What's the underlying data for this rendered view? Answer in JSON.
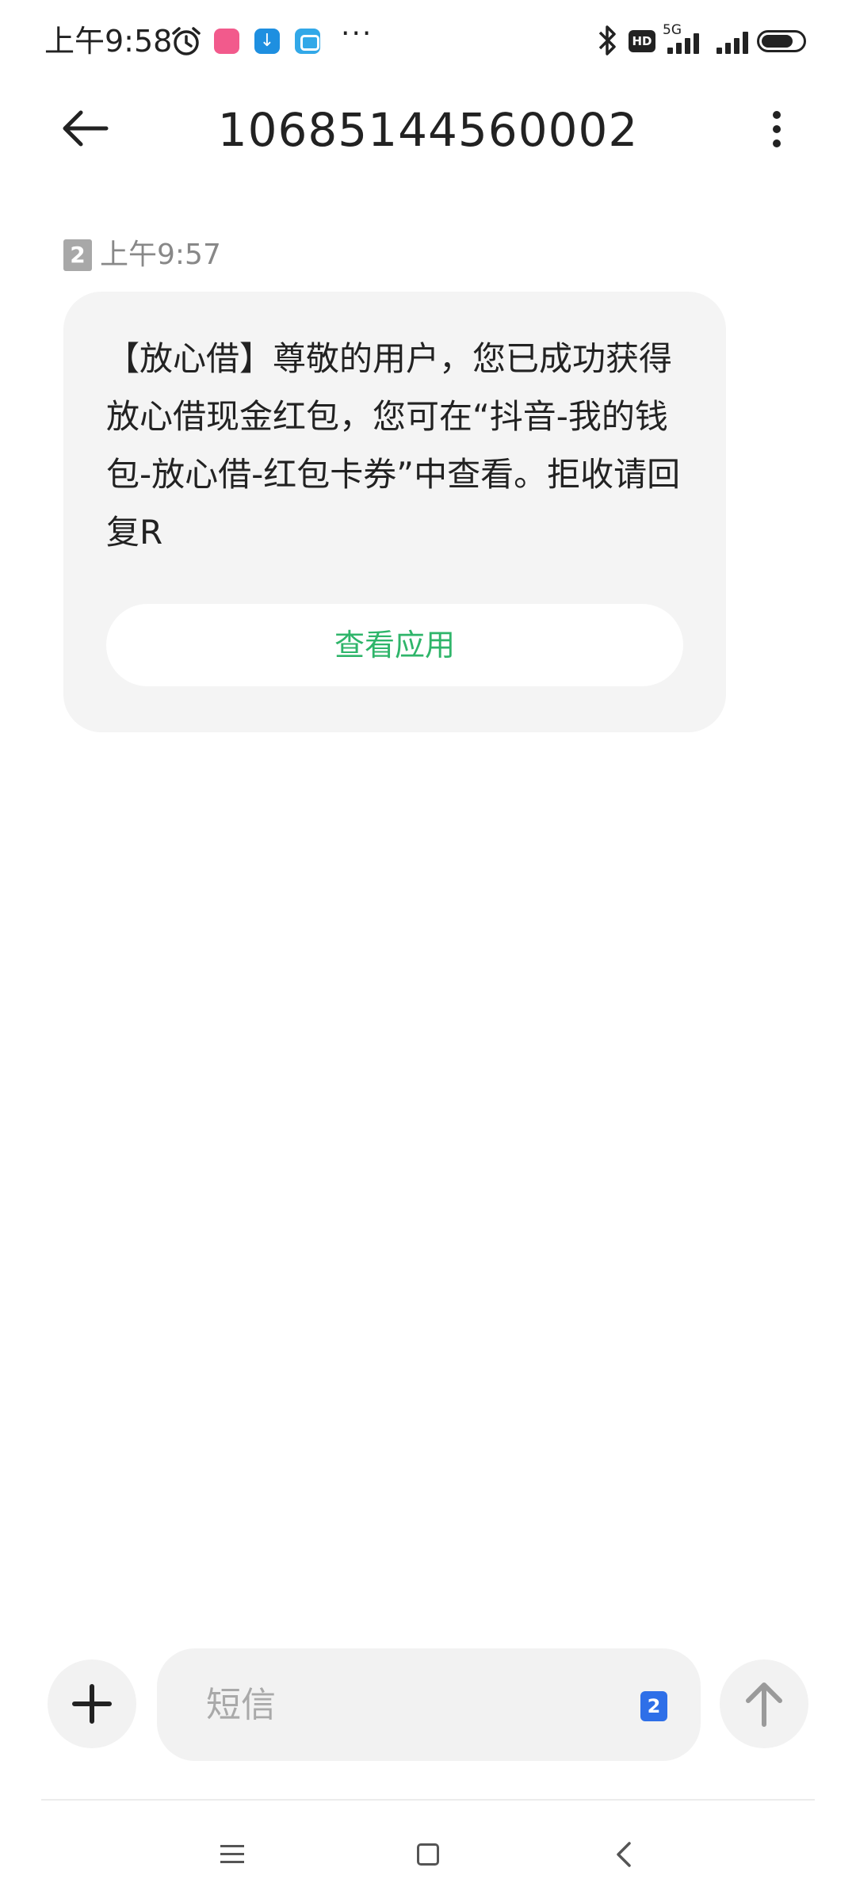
{
  "status_bar": {
    "time": "上午9:58",
    "network_type": "5G",
    "hd_label": "HD",
    "icons": [
      "alarm-icon",
      "app-notification-icon",
      "download-icon",
      "message-app-icon",
      "more-dots-icon",
      "bluetooth-icon",
      "hd-icon",
      "signal-icon",
      "battery-icon"
    ]
  },
  "header": {
    "title": "10685144560002",
    "back_icon": "arrow-left-icon",
    "menu_icon": "more-vertical-icon"
  },
  "messages": [
    {
      "sim": "2",
      "time": "上午9:57",
      "text": "【放心借】尊敬的用户，您已成功获得放心借现金红包，您可在“抖音-我的钱包-放心借-红包卡券”中查看。拒收请回复R",
      "action_label": "查看应用"
    }
  ],
  "composer": {
    "placeholder": "短信",
    "sim_label": "2",
    "attach_icon": "plus-icon",
    "send_icon": "arrow-up-icon"
  },
  "colors": {
    "accent_green": "#2fb56a",
    "sim_blue": "#2e6fe8",
    "bubble_bg": "#f4f4f4"
  }
}
